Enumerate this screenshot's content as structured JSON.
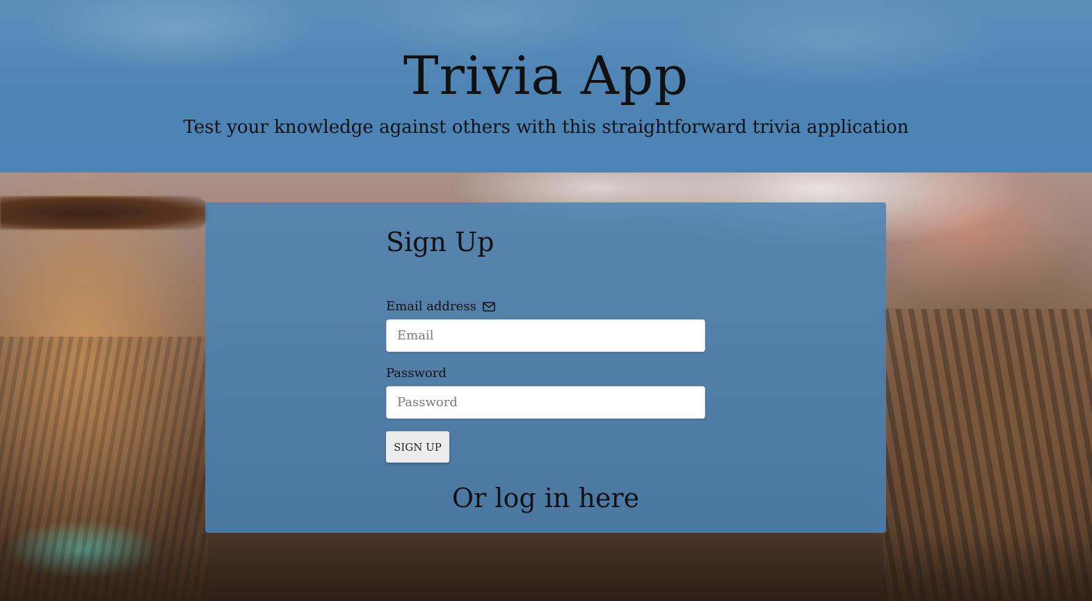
{
  "header": {
    "title": "Trivia App",
    "subtitle": "Test your knowledge against others with this straightforward trivia application"
  },
  "signup_form": {
    "title": "Sign Up",
    "email_label": "Email address",
    "email_icon": "envelope-icon",
    "email_placeholder": "Email",
    "email_value": "",
    "password_label": "Password",
    "password_placeholder": "Password",
    "password_value": "",
    "submit_label": "Sign Up"
  },
  "login_link": {
    "label": "Or log in here"
  },
  "colors": {
    "header_bg": "#4a83b6",
    "card_bg": "#4a83b6",
    "button_bg": "#ececec",
    "text": "#111111"
  }
}
